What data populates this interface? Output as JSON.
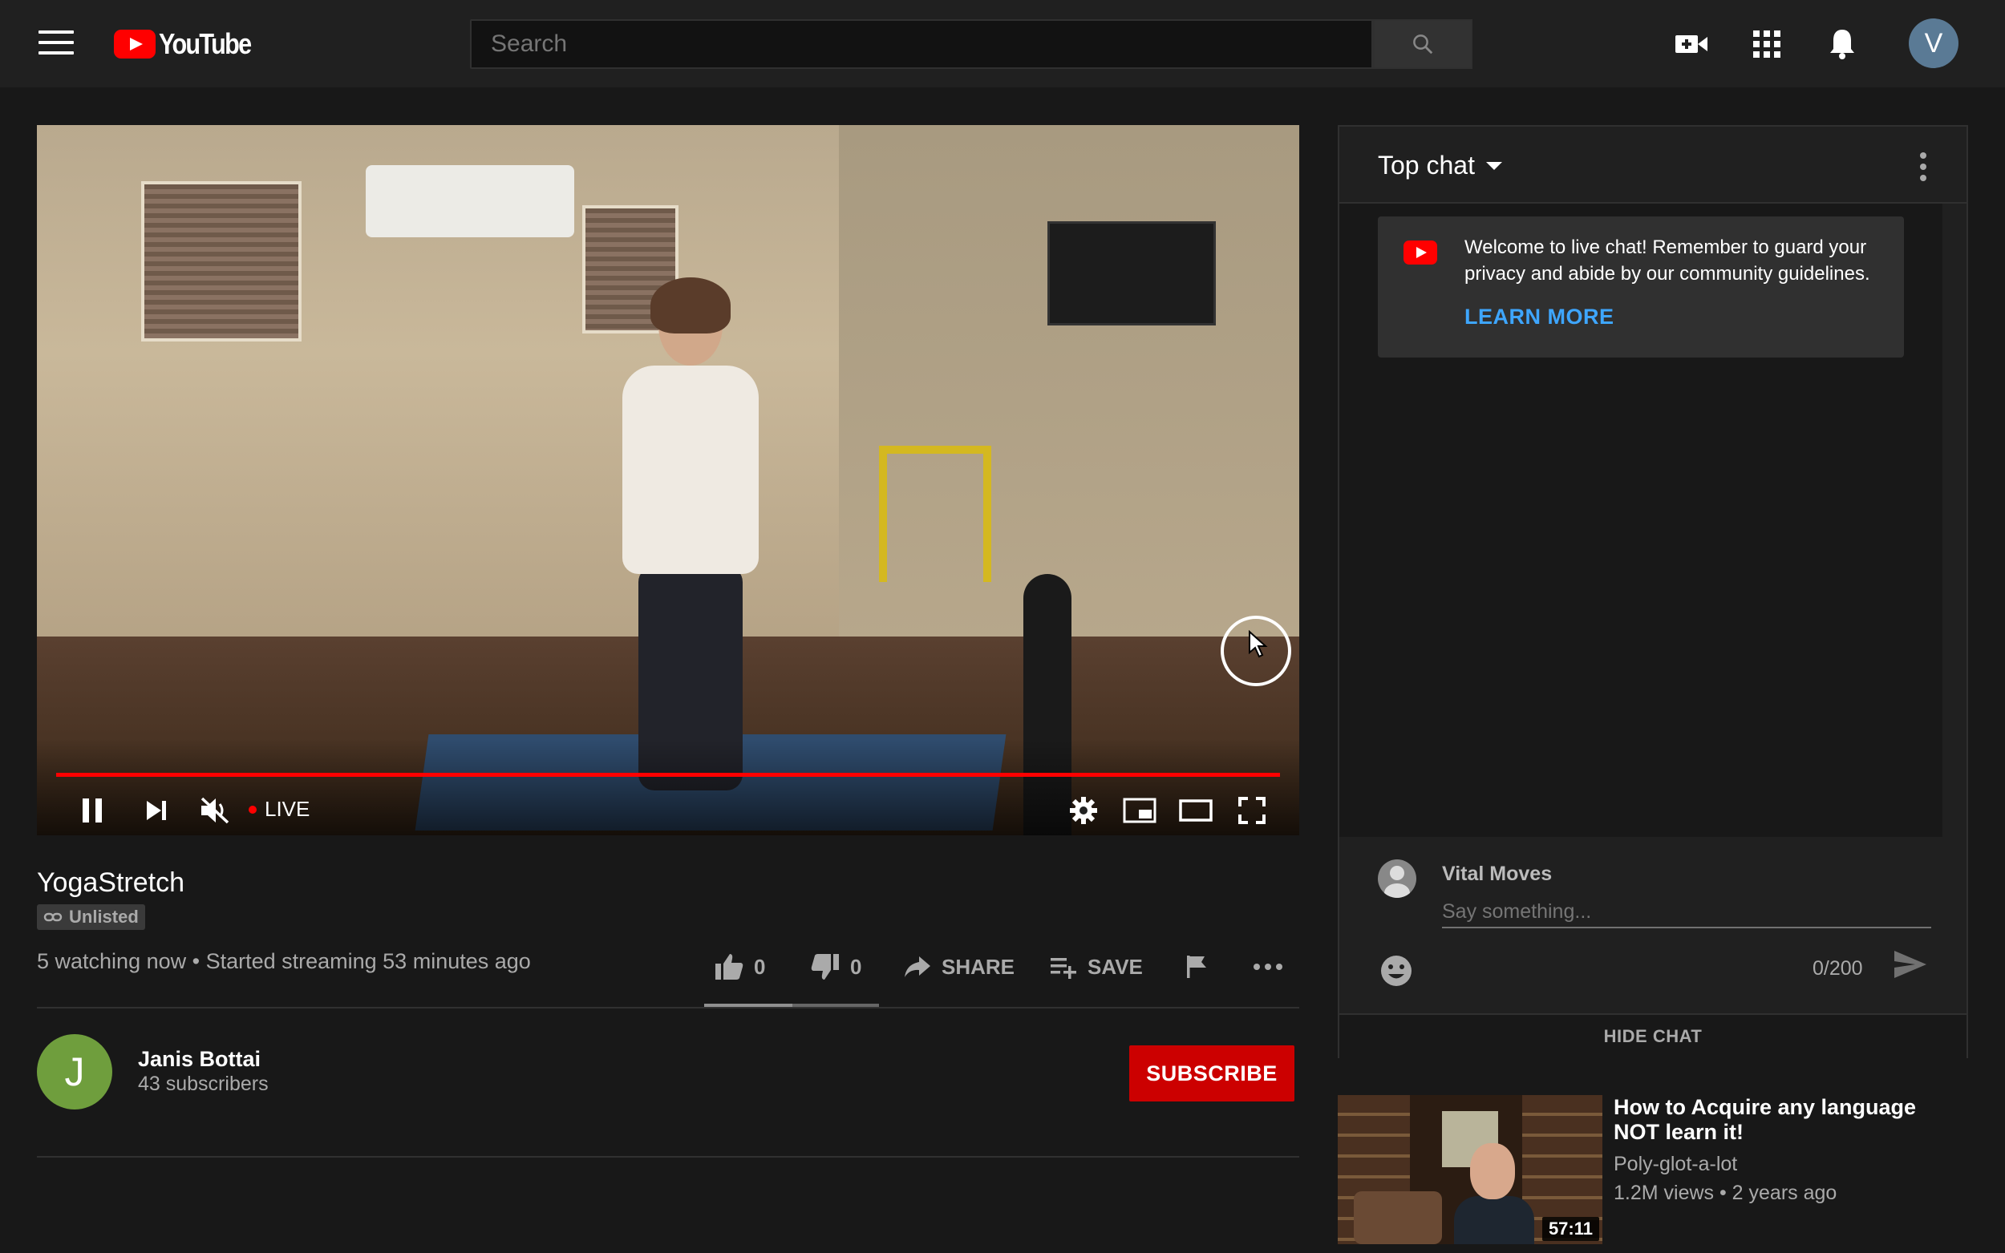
{
  "masthead": {
    "logo_text": "YouTube",
    "search_placeholder": "Search",
    "avatar_letter": "V"
  },
  "player": {
    "live_label": "LIVE",
    "progress": 1.0
  },
  "video": {
    "title": "YogaStretch",
    "privacy": "Unlisted",
    "meta": "5 watching now • Started streaming 53 minutes ago",
    "likes": "0",
    "dislikes": "0",
    "share_label": "SHARE",
    "save_label": "SAVE"
  },
  "channel": {
    "avatar_letter": "J",
    "name": "Janis Bottai",
    "subscribers": "43 subscribers",
    "subscribe_label": "SUBSCRIBE",
    "avatar_color": "#6f9e3d"
  },
  "chat": {
    "title": "Top chat",
    "welcome_text": "Welcome to live chat! Remember to guard your privacy and abide by our community guidelines.",
    "learn_more": "LEARN MORE",
    "user_name": "Vital Moves",
    "input_placeholder": "Say something...",
    "char_count": "0/200",
    "hide_label": "HIDE CHAT"
  },
  "recommendation": {
    "title": "How to Acquire any language NOT learn it!",
    "channel": "Poly-glot-a-lot",
    "meta": "1.2M views • 2 years ago",
    "duration": "57:11"
  },
  "colors": {
    "accent": "#ff0000",
    "link": "#3ea6ff",
    "subscribe": "#cc0000"
  }
}
